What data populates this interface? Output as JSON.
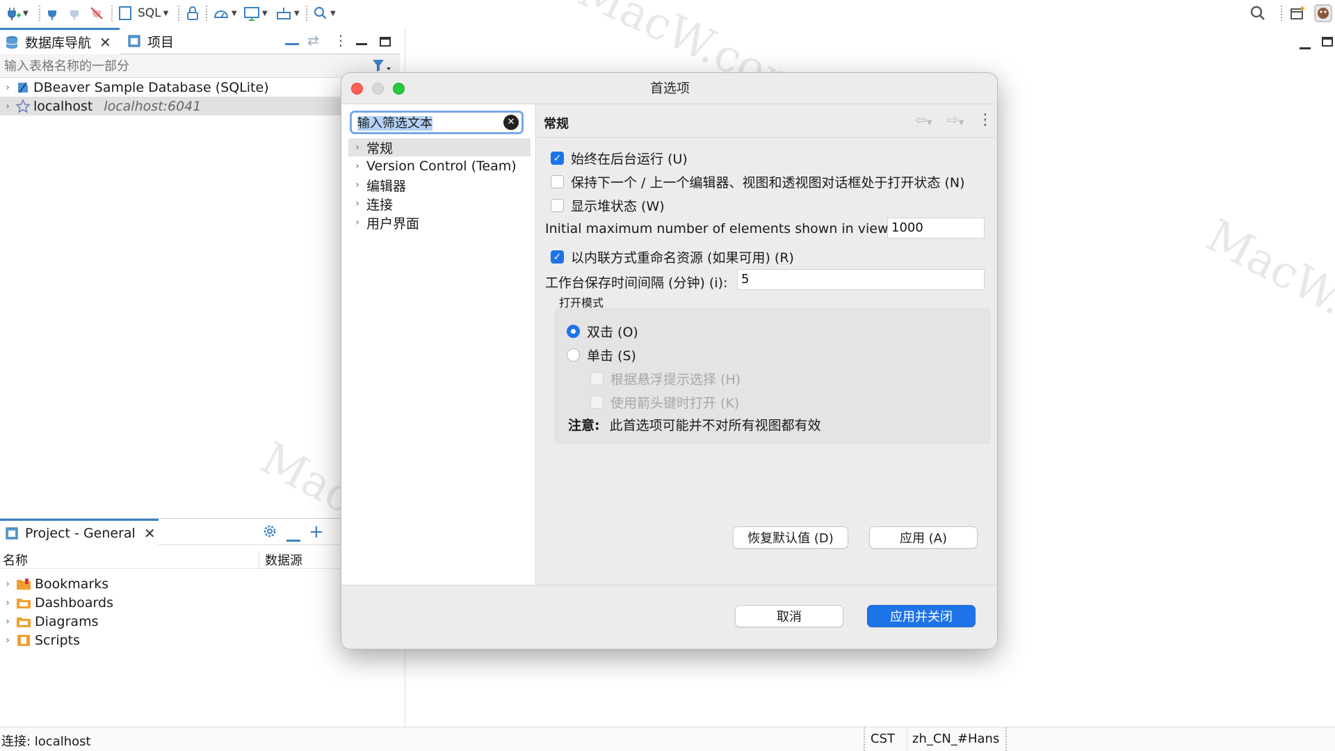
{
  "toolbar": {
    "sql_label": "SQL"
  },
  "navigator": {
    "tab_db": "数据库导航",
    "tab_project": "项目",
    "filter_placeholder": "输入表格名称的一部分",
    "items": [
      {
        "label": "DBeaver Sample Database (SQLite)",
        "sub": ""
      },
      {
        "label": "localhost",
        "sub": "localhost:6041"
      }
    ]
  },
  "project": {
    "tab_label": "Project - General",
    "col_name": "名称",
    "col_datasource": "数据源",
    "items": [
      {
        "label": "Bookmarks"
      },
      {
        "label": "Dashboards"
      },
      {
        "label": "Diagrams"
      },
      {
        "label": "Scripts"
      }
    ]
  },
  "statusbar": {
    "connection": "连接: localhost",
    "timezone": "CST",
    "locale": "zh_CN_#Hans"
  },
  "dialog": {
    "title": "首选项",
    "filter_value": "输入筛选文本",
    "categories": [
      {
        "label": "常规"
      },
      {
        "label": "Version Control (Team)"
      },
      {
        "label": "编辑器"
      },
      {
        "label": "连接"
      },
      {
        "label": "用户界面"
      }
    ],
    "page_title": "常规",
    "options": {
      "always_run_background": "始终在后台运行 (U)",
      "keep_next_prev": "保持下一个 / 上一个编辑器、视图和透视图对话框处于打开状态 (N)",
      "show_heap": "显示堆状态 (W)",
      "initial_max_label": "Initial maximum number of elements shown in views:",
      "initial_max_value": "1000",
      "inline_rename": "以内联方式重命名资源 (如果可用) (R)",
      "save_interval_label": "工作台保存时间间隔 (分钟) (i):",
      "save_interval_value": "5"
    },
    "open_mode": {
      "group_label": "打开模式",
      "double_click": "双击 (O)",
      "single_click": "单击 (S)",
      "hover_select": "根据悬浮提示选择 (H)",
      "arrow_open": "使用箭头键时打开 (K)",
      "note_label": "注意:",
      "note_text": "此首选项可能并不对所有视图都有效"
    },
    "buttons": {
      "restore_defaults": "恢复默认值 (D)",
      "apply": "应用 (A)",
      "cancel": "取消",
      "apply_close": "应用并关闭"
    }
  },
  "watermark": {
    "text": "MacW.com"
  },
  "colors": {
    "accent": "#1e73e8",
    "close_light": "#fe5f57",
    "min_light": "#d8d8d8",
    "max_light": "#28c840"
  }
}
